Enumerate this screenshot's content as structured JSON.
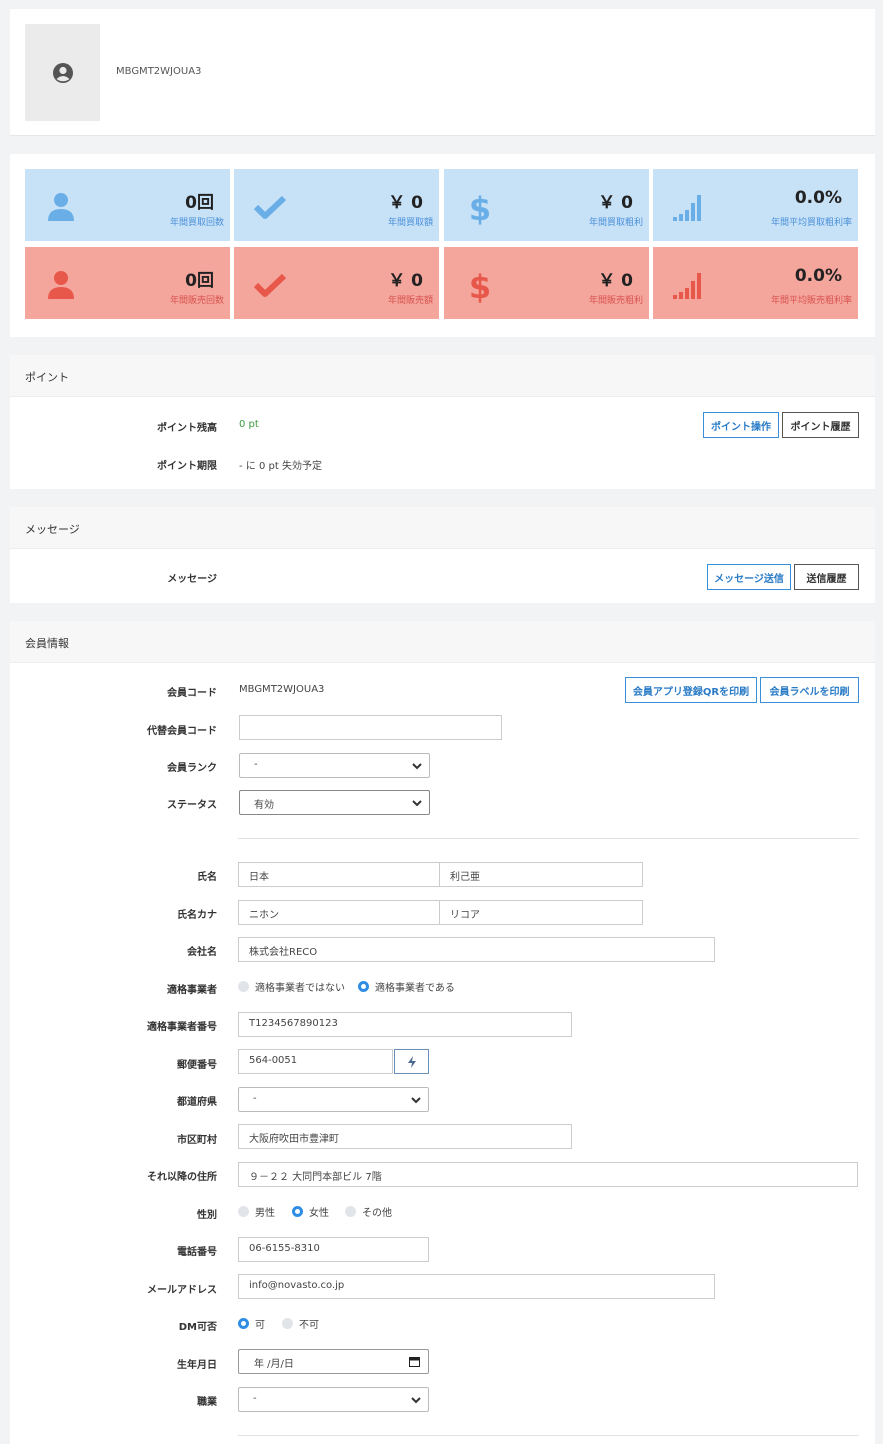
{
  "profile": {
    "code": "MBGMT2WJOUA3"
  },
  "stats": {
    "buy": [
      {
        "icon": "user-icon",
        "value": "0回",
        "label": "年間買取回数"
      },
      {
        "icon": "check-icon",
        "value": "￥ 0",
        "label": "年間買取額"
      },
      {
        "icon": "dollar-icon",
        "value": "￥ 0",
        "label": "年間買取粗利"
      },
      {
        "icon": "signal-bars-icon",
        "value": "0.0%",
        "label": "年間平均買取粗利率"
      }
    ],
    "sell": [
      {
        "icon": "user-icon",
        "value": "0回",
        "label": "年間販売回数"
      },
      {
        "icon": "check-icon",
        "value": "￥ 0",
        "label": "年間販売額"
      },
      {
        "icon": "dollar-icon",
        "value": "￥ 0",
        "label": "年間販売粗利"
      },
      {
        "icon": "signal-bars-icon",
        "value": "0.0%",
        "label": "年間平均販売粗利率"
      }
    ],
    "colors": {
      "buy_bg": "#c7e1f7",
      "buy_icon": "#6aaee8",
      "sell_bg": "#f4a59c",
      "sell_icon": "#e8584a"
    }
  },
  "points": {
    "title": "ポイント",
    "balance_label": "ポイント残高",
    "balance_value": "0 pt",
    "expiry_label": "ポイント期限",
    "expiry_value": "- に 0 pt 失効予定",
    "operate_button": "ポイント操作",
    "history_button": "ポイント履歴"
  },
  "messages": {
    "title": "メッセージ",
    "label": "メッセージ",
    "send_button": "メッセージ送信",
    "history_button": "送信履歴"
  },
  "member": {
    "title": "会員情報",
    "code_label": "会員コード",
    "code_value": "MBGMT2WJOUA3",
    "print_qr_button": "会員アプリ登録QRを印刷",
    "print_label_button": "会員ラベルを印刷",
    "alt_code_label": "代替会員コード",
    "alt_code_value": "",
    "rank_label": "会員ランク",
    "rank_value": "-",
    "status_label": "ステータス",
    "status_value": "有効",
    "name_label": "氏名",
    "last_name": "日本",
    "first_name": "利己亜",
    "kana_label": "氏名カナ",
    "last_kana": "ニホン",
    "first_kana": "リコア",
    "company_label": "会社名",
    "company_value": "株式会社RECO",
    "qualified_label": "適格事業者",
    "qualified_options": [
      "適格事業者ではない",
      "適格事業者である"
    ],
    "qualified_selected": 1,
    "qualified_number_label": "適格事業者番号",
    "qualified_number_value": "T1234567890123",
    "zip_label": "郵便番号",
    "zip_value": "564-0051",
    "prefecture_label": "都道府県",
    "prefecture_value": "-",
    "city_label": "市区町村",
    "city_value": "大阪府吹田市豊津町",
    "address_label": "それ以降の住所",
    "address_value": "９－２２ 大同門本部ビル 7階",
    "gender_label": "性別",
    "gender_options": [
      "男性",
      "女性",
      "その他"
    ],
    "gender_selected": 1,
    "phone_label": "電話番号",
    "phone_value": "06-6155-8310",
    "email_label": "メールアドレス",
    "email_value": "info@novasto.co.jp",
    "dm_label": "DM可否",
    "dm_options": [
      "可",
      "不可"
    ],
    "dm_selected": 0,
    "birthday_label": "生年月日",
    "birthday_value": "年 /月/日",
    "job_label": "職業",
    "job_value": "-"
  }
}
